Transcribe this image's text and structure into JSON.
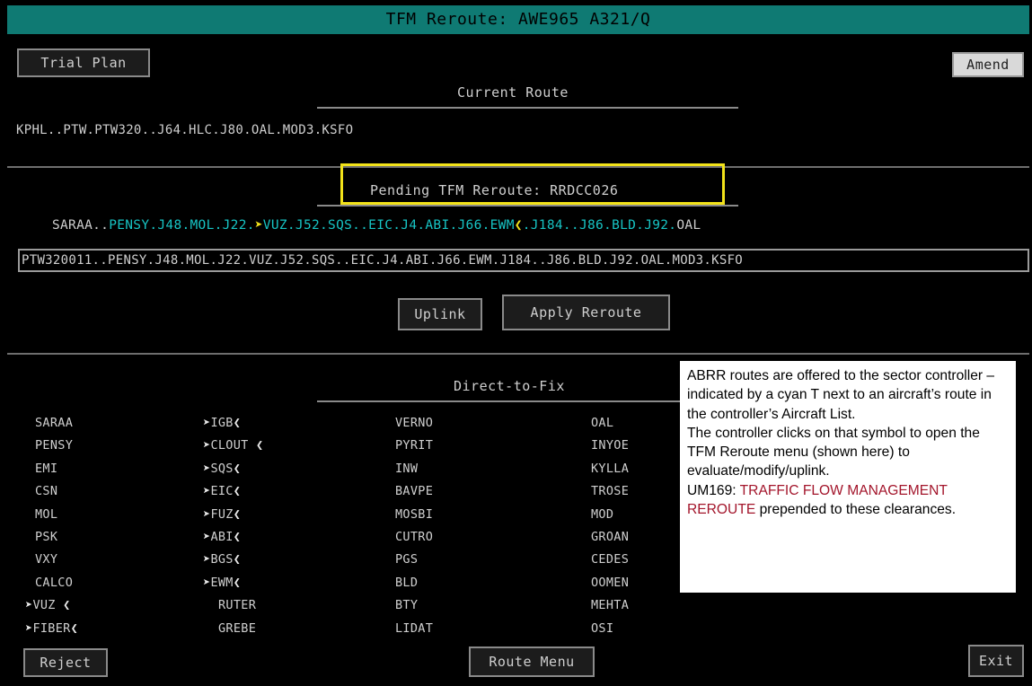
{
  "window": {
    "title": "TFM Reroute: AWE965 A321/Q"
  },
  "toolbar": {
    "trial_plan": "Trial Plan",
    "amend": "Amend"
  },
  "current": {
    "heading": "Current Route",
    "route": "KPHL..PTW.PTW320..J64.HLC.J80.OAL.MOD3.KSFO"
  },
  "pending": {
    "heading": "Pending TFM Reroute: RRDCC026",
    "seg_start": "SARAA..",
    "seg_cyan1": "PENSY.J48.MOL.J22.",
    "marker_left": "➤",
    "seg_cyan2": "VUZ.J52.SQS..EIC.J4.ABI.J66.EWM",
    "marker_right": "❮",
    "seg_cyan3": ".J184..J86.BLD.J92.",
    "seg_end": "OAL",
    "edit_value": "PTW320011..PENSY.J48.MOL.J22.VUZ.J52.SQS..EIC.J4.ABI.J66.EWM.J184..J86.BLD.J92.OAL.MOD3.KSFO"
  },
  "actions": {
    "uplink": "Uplink",
    "apply": "Apply Reroute"
  },
  "direct": {
    "heading": "Direct-to-Fix",
    "col1": [
      "SARAA",
      "PENSY",
      "EMI",
      "CSN",
      "MOL",
      "PSK",
      "VXY",
      "CALCO",
      "VUZ",
      "FIBER"
    ],
    "col2": [
      "IGB",
      "CLOUT",
      "SQS",
      "EIC",
      "FUZ",
      "ABI",
      "BGS",
      "EWM",
      "RUTER",
      "GREBE"
    ],
    "col3": [
      "VERNO",
      "PYRIT",
      "INW",
      "BAVPE",
      "MOSBI",
      "CUTRO",
      "PGS",
      "BLD",
      "BTY",
      "LIDAT"
    ],
    "col4": [
      "OAL",
      "INYOE",
      "KYLLA",
      "TROSE",
      "MOD",
      "GROAN",
      "CEDES",
      "OOMEN",
      "MEHTA",
      "OSI"
    ]
  },
  "note": {
    "p1": "ABRR routes are offered to the sector controller – indicated by a cyan T next to an aircraft’s route in the controller’s Aircraft List.",
    "p2": "The controller clicks on that symbol to open the TFM Reroute menu (shown here) to evaluate/modify/uplink.",
    "p3_prefix": "UM169: ",
    "p3_red": "TRAFFIC FLOW MANAGEMENT REROUTE",
    "p3_suffix": " prepended to these clearances."
  },
  "footer": {
    "reject": "Reject",
    "route_menu": "Route Menu",
    "exit": "Exit"
  },
  "colors": {
    "title_bar": "#0f7a73",
    "cyan": "#17c4c4",
    "highlight": "#f2e21a",
    "note_red": "#a3152b"
  }
}
